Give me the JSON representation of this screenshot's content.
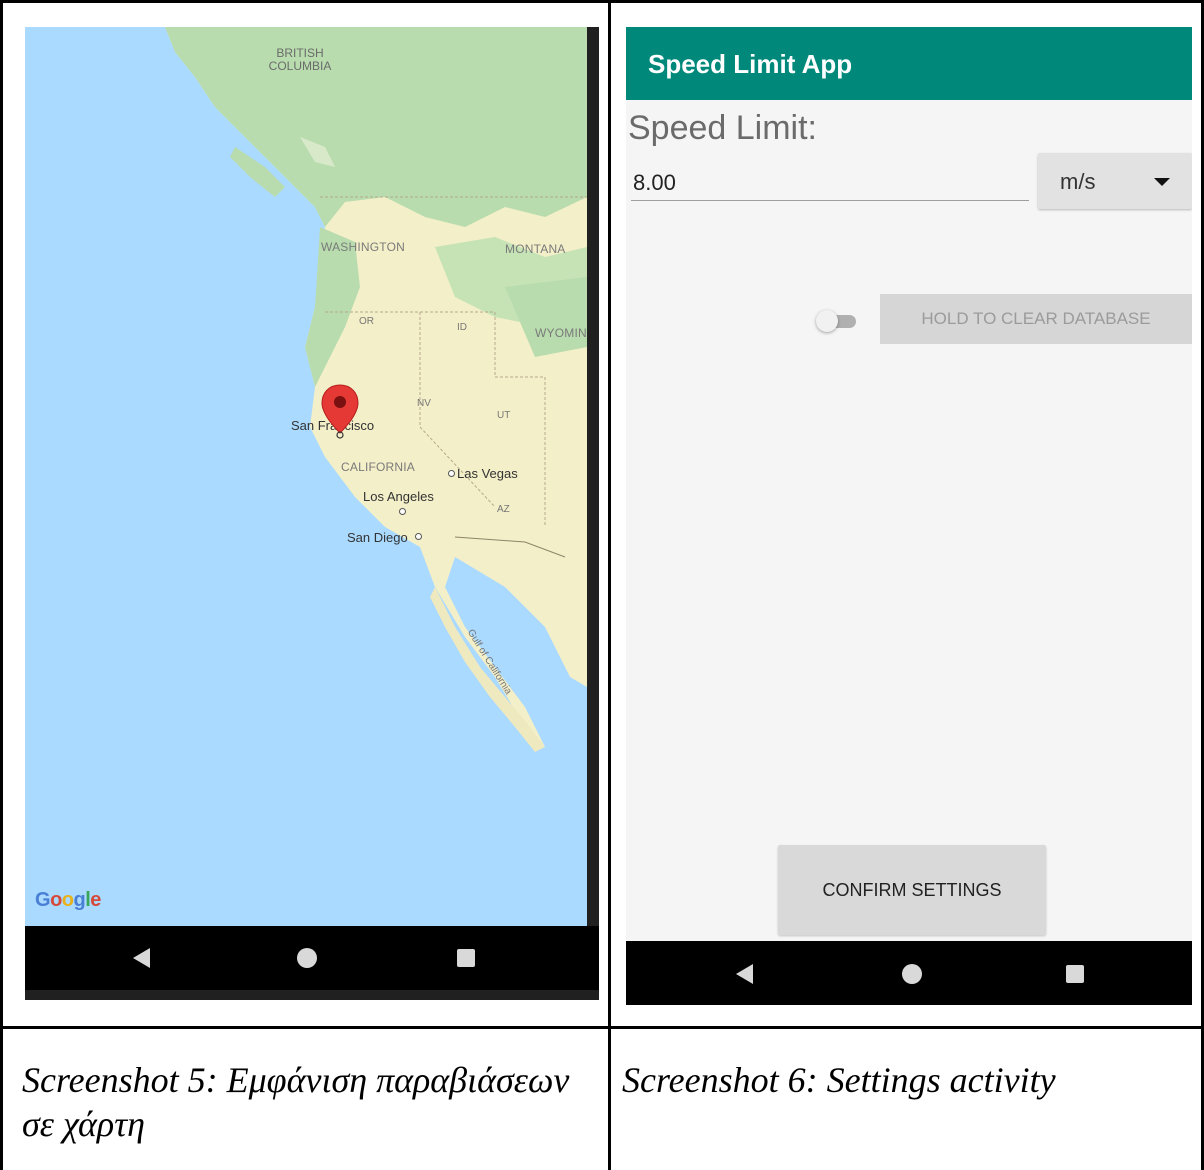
{
  "map_screen": {
    "labels": {
      "british_columbia": "BRITISH COLUMBIA",
      "washington": "WASHINGTON",
      "montana": "MONTANA",
      "or": "OR",
      "id": "ID",
      "wyoming": "WYOMIN",
      "nv": "NV",
      "ut": "UT",
      "california": "CALIFORNIA",
      "san_francisco": "San Francisco",
      "las_vegas": "Las Vegas",
      "los_angeles": "Los Angeles",
      "az": "AZ",
      "san_diego": "San Diego",
      "gulf": "Gulf of California"
    },
    "marker_icon": "map-pin-icon",
    "marker_color": "#e53935",
    "logo": "Google",
    "water_color": "#aadaff",
    "land_color": "#f3efc8",
    "forest_color": "#b8dcae"
  },
  "settings_screen": {
    "app_title": "Speed Limit App",
    "appbar_color": "#00897b",
    "speed_label": "Speed Limit:",
    "speed_value": "8.00",
    "unit_selected": "m/s",
    "clear_button": "HOLD TO CLEAR DATABASE",
    "toggle_state": "off",
    "confirm_button": "CONFIRM SETTINGS"
  },
  "navbar_icons": [
    "back-icon",
    "home-icon",
    "recent-apps-icon"
  ],
  "captions": {
    "left": "Screenshot 5: Εμφάνιση παραβιάσεων σε χάρτη",
    "right": "Screenshot 6: Settings activity"
  }
}
